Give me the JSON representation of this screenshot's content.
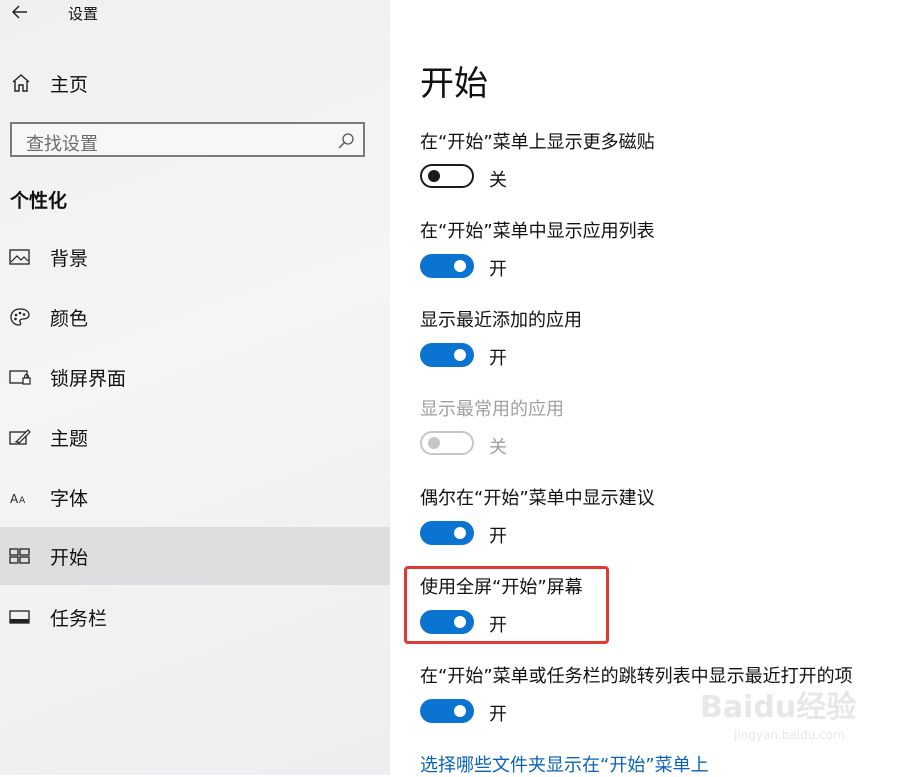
{
  "window": {
    "title": "设置"
  },
  "sidebar": {
    "home_label": "主页",
    "search_placeholder": "查找设置",
    "section_title": "个性化",
    "items": [
      {
        "label": "背景",
        "icon": "picture-icon"
      },
      {
        "label": "颜色",
        "icon": "palette-icon"
      },
      {
        "label": "锁屏界面",
        "icon": "lock-screen-icon"
      },
      {
        "label": "主题",
        "icon": "theme-brush-icon"
      },
      {
        "label": "字体",
        "icon": "font-icon"
      },
      {
        "label": "开始",
        "icon": "start-layout-icon",
        "selected": true
      },
      {
        "label": "任务栏",
        "icon": "taskbar-icon"
      }
    ]
  },
  "main": {
    "title": "开始",
    "settings": [
      {
        "label": "在“开始”菜单上显示更多磁贴",
        "state": "off",
        "state_label": "关"
      },
      {
        "label": "在“开始”菜单中显示应用列表",
        "state": "on",
        "state_label": "开"
      },
      {
        "label": "显示最近添加的应用",
        "state": "on",
        "state_label": "开"
      },
      {
        "label": "显示最常用的应用",
        "state": "disabled-off",
        "state_label": "关"
      },
      {
        "label": "偶尔在“开始”菜单中显示建议",
        "state": "on",
        "state_label": "开"
      },
      {
        "label": "使用全屏“开始”屏幕",
        "state": "on",
        "state_label": "开",
        "highlighted": true
      },
      {
        "label": "在“开始”菜单或任务栏的跳转列表中显示最近打开的项",
        "state": "on",
        "state_label": "开"
      }
    ],
    "link_label": "选择哪些文件夹显示在“开始”菜单上"
  },
  "colors": {
    "accent": "#0a74d0",
    "highlight": "#e03a34",
    "link": "#0a63b8"
  },
  "watermark": {
    "text": "Baidu经验",
    "sub": "jingyan.baidu.com"
  }
}
